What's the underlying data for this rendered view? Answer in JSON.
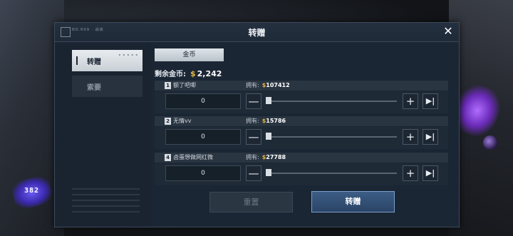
{
  "background": {
    "level_badge": "382"
  },
  "dialog": {
    "title": "转赠",
    "logo_text": "NO.R09 · 战绩"
  },
  "sidebar": {
    "items": [
      {
        "label": "转赠",
        "active": true
      },
      {
        "label": "索要",
        "active": false
      }
    ]
  },
  "currency_tab": {
    "label": "金币"
  },
  "remaining": {
    "label": "剩余金币:",
    "coin_symbol": "$",
    "amount": "2,242"
  },
  "rows": [
    {
      "index": "1",
      "name": "额了吧唧",
      "own_label": "拥有:",
      "coin_symbol": "$",
      "own_value": "107412",
      "quantity": "0",
      "slider_fraction": 0
    },
    {
      "index": "2",
      "name": "无情vv",
      "own_label": "拥有:",
      "coin_symbol": "$",
      "own_value": "15786",
      "quantity": "0",
      "slider_fraction": 0
    },
    {
      "index": "4",
      "name": "卤蛋想做网红微",
      "own_label": "拥有:",
      "coin_symbol": "$",
      "own_value": "27788",
      "quantity": "0",
      "slider_fraction": 0
    }
  ],
  "buttons": {
    "reset": "重置",
    "confirm": "转赠",
    "minus": "—",
    "plus": "+",
    "max": "▶|"
  },
  "colors": {
    "coin": "#e3b441",
    "accent": "#7aa0cc",
    "panel": "#1b2634"
  },
  "icons": {
    "close": "close-icon",
    "coin": "dollar-icon"
  }
}
